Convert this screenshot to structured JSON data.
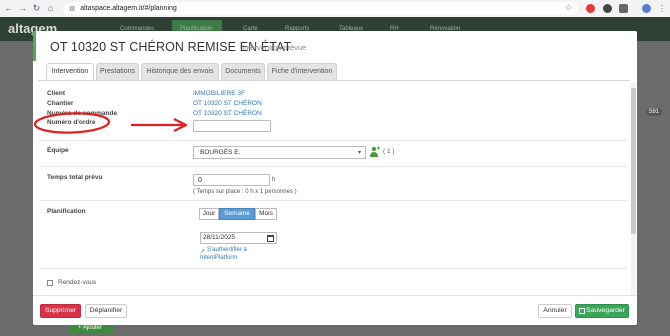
{
  "browser": {
    "url": "altaspace.altagem.it/#/planning",
    "nav_back": "←",
    "nav_forward": "→",
    "nav_reload": "↻",
    "nav_home": "⌂",
    "star": "☆"
  },
  "app": {
    "logo": "altagem",
    "menu": [
      "Commandes",
      "Planification",
      "Carte",
      "Rapports",
      "Tableaux",
      "RH",
      "Rénovation"
    ],
    "badge_count": "591",
    "add_button": "+ Ajouter"
  },
  "modal": {
    "title": "OT 10320 ST CHÉRON REMISE EN ÉTAT",
    "subtitle": "Intervention prévue",
    "tabs": [
      {
        "label": "Intervention",
        "active": true
      },
      {
        "label": "Prestations",
        "active": false
      },
      {
        "label": "Historique des envois",
        "active": false
      },
      {
        "label": "Documents",
        "active": false
      },
      {
        "label": "Fiche d'intervention",
        "active": false
      }
    ],
    "fields": {
      "client_label": "Client",
      "client_value": "IMMOBILIERE 3F",
      "chantier_label": "Chantier",
      "chantier_value": "OT 10320 ST CHÉRON",
      "commande_label": "Numéro de commande",
      "commande_value": "OT 10320 ST CHÉRON",
      "ordre_label": "Numéro d'ordre",
      "ordre_value": ""
    },
    "equipe": {
      "label": "Équipe",
      "selected": "BOURGÈS E.",
      "count": "( 1 )"
    },
    "temps": {
      "label": "Temps total prévu",
      "value": "0",
      "unit": "h",
      "note": "( Temps sur place : 0 h x 1 personnes )"
    },
    "planification": {
      "label": "Planification",
      "views": [
        {
          "label": "Jour",
          "active": false
        },
        {
          "label": "Semaine",
          "active": true
        },
        {
          "label": "Mois",
          "active": false
        }
      ],
      "date": "28/11/2025",
      "auth_line1": "S'authentifier à",
      "auth_line2": "IntentPlatform"
    },
    "rendez_vous": "Rendez-vous",
    "buttons": {
      "delete": "Supprimer",
      "unplan": "Déplanifier",
      "cancel": "Annuler",
      "save": "Sauvegarder"
    }
  },
  "colors": {
    "accent_green": "#4caf50",
    "link_blue": "#337ab7",
    "danger_red": "#d9334a",
    "success_green": "#3aa65a",
    "annotation_red": "#e02020"
  }
}
